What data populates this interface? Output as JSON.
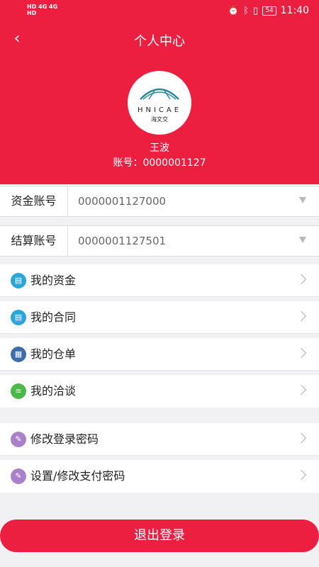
{
  "status_bar": {
    "left_top": "HD 4G 4G",
    "left_bottom": "HD",
    "battery": "54",
    "time": "11:40"
  },
  "header": {
    "title": "个人中心",
    "logo_text": "HNICAE",
    "logo_sub": "海文交",
    "username": "王波",
    "account_label": "账号：",
    "account_value": "0000001127"
  },
  "selects": [
    {
      "label": "资金账号",
      "value": "0000001127000"
    },
    {
      "label": "结算账号",
      "value": "0000001127501"
    }
  ],
  "menu": [
    {
      "label": "我的资金",
      "icon": "fund-doc-icon",
      "color": "#2aa6d9"
    },
    {
      "label": "我的合同",
      "icon": "contract-doc-icon",
      "color": "#2aa6d9"
    },
    {
      "label": "我的仓单",
      "icon": "warehouse-receipt-icon",
      "color": "#3b6ea8"
    },
    {
      "label": "我的洽谈",
      "icon": "chat-lines-icon",
      "color": "#4cb848"
    },
    {
      "label": "修改登录密码",
      "icon": "edit-password-icon",
      "color": "#a981c9"
    },
    {
      "label": "设置/修改支付密码",
      "icon": "edit-pay-password-icon",
      "color": "#a981c9"
    }
  ],
  "logout_label": "退出登录",
  "colors": {
    "brand": "#ec1f41",
    "background": "#f1f1f3"
  }
}
